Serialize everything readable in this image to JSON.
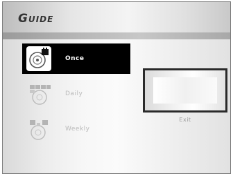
{
  "header": {
    "title": "Guide"
  },
  "menu": {
    "items": [
      {
        "label": "Once",
        "icon": "disc-timer-icon",
        "selected": true
      },
      {
        "label": "Daily",
        "icon": "calendar-disc-icon",
        "selected": false
      },
      {
        "label": "Weekly",
        "icon": "weekly-disc-icon",
        "selected": false
      }
    ]
  },
  "preview": {
    "exit_label": "Exit"
  },
  "colors": {
    "selected_bg": "#000000",
    "selected_text": "#ffffff",
    "inactive_text": "#b9b9b9"
  }
}
